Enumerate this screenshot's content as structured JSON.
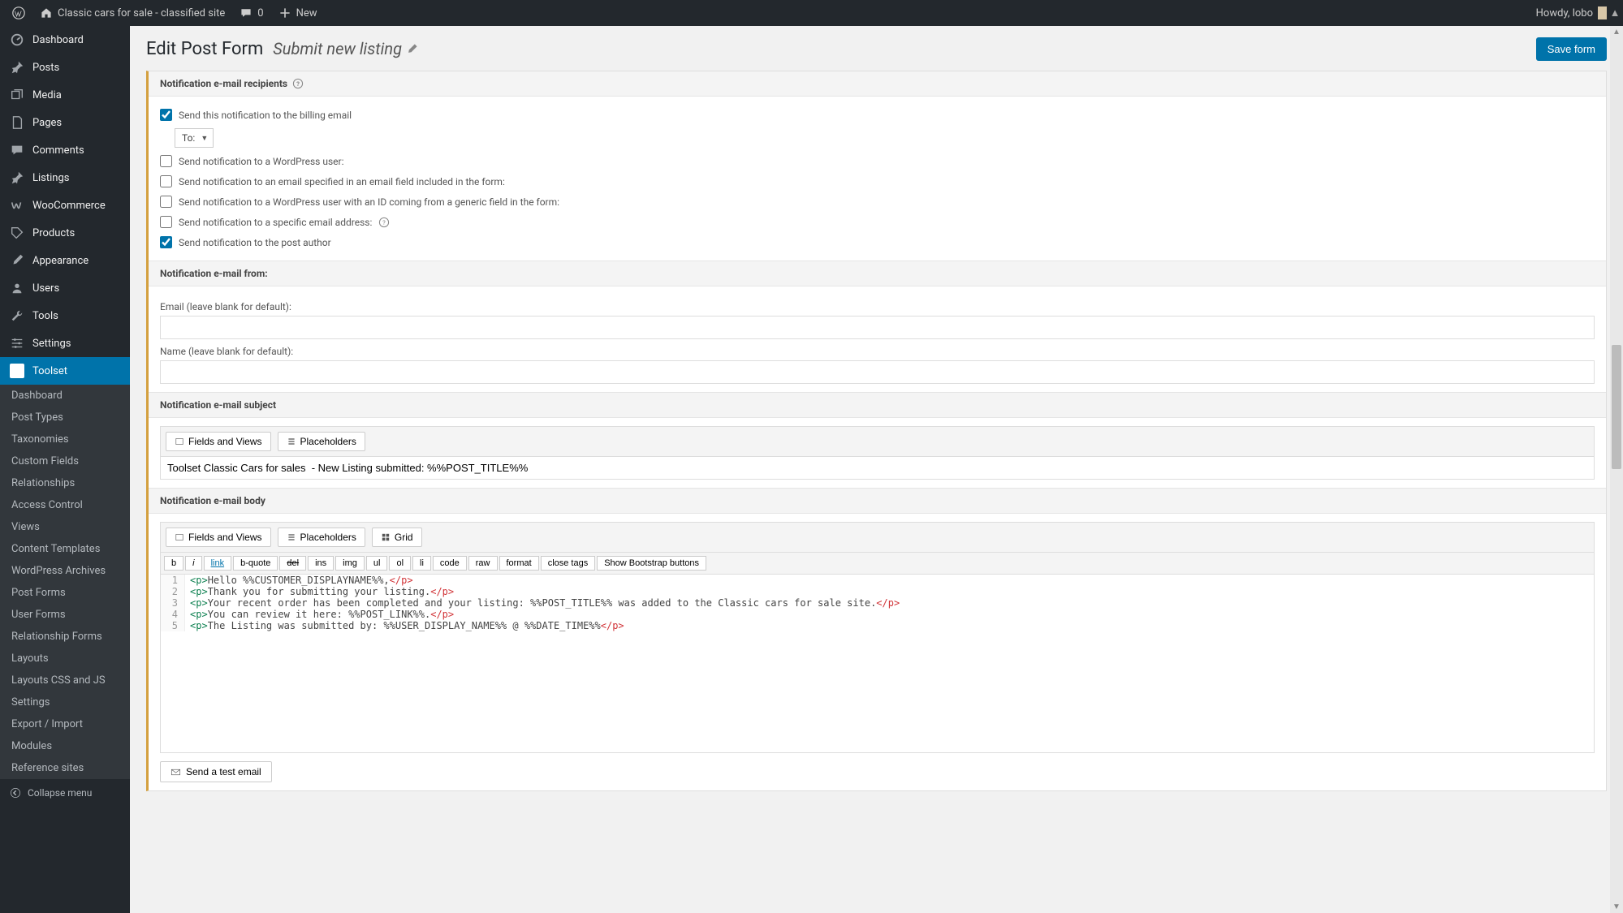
{
  "adminbar": {
    "site": "Classic cars for sale - classified site",
    "comments": "0",
    "new": "New",
    "howdy": "Howdy, lobo"
  },
  "sidebar": {
    "items": [
      {
        "label": "Dashboard"
      },
      {
        "label": "Posts"
      },
      {
        "label": "Media"
      },
      {
        "label": "Pages"
      },
      {
        "label": "Comments"
      },
      {
        "label": "Listings"
      },
      {
        "label": "WooCommerce"
      },
      {
        "label": "Products"
      },
      {
        "label": "Appearance"
      },
      {
        "label": "Users"
      },
      {
        "label": "Tools"
      },
      {
        "label": "Settings"
      },
      {
        "label": "Toolset"
      }
    ],
    "sub": [
      "Dashboard",
      "Post Types",
      "Taxonomies",
      "Custom Fields",
      "Relationships",
      "Access Control",
      "Views",
      "Content Templates",
      "WordPress Archives",
      "Post Forms",
      "User Forms",
      "Relationship Forms",
      "Layouts",
      "Layouts CSS and JS",
      "Settings",
      "Export / Import",
      "Modules",
      "Reference sites"
    ],
    "collapse": "Collapse menu"
  },
  "page": {
    "title": "Edit Post Form",
    "subtitle": "Submit new listing",
    "save": "Save form"
  },
  "sections": {
    "recipients": "Notification e-mail recipients",
    "from": "Notification e-mail from:",
    "subject": "Notification e-mail subject",
    "body": "Notification e-mail body"
  },
  "recipients": {
    "billing": "Send this notification to the billing email",
    "to": "To:",
    "wp_user": "Send notification to a WordPress user:",
    "email_field": "Send notification to an email specified in an email field included in the form:",
    "wp_user_id": "Send notification to a WordPress user with an ID coming from a generic field in the form:",
    "specific": "Send notification to a specific email address:",
    "author": "Send notification to the post author"
  },
  "from": {
    "email_label": "Email (leave blank for default):",
    "name_label": "Name (leave blank for default):"
  },
  "tools": {
    "fields": "Fields and Views",
    "placeholders": "Placeholders",
    "grid": "Grid"
  },
  "subject_value": "Toolset Classic Cars for sales  - New Listing submitted: %%POST_TITLE%%",
  "quicktags": [
    "b",
    "i",
    "link",
    "b-quote",
    "del",
    "ins",
    "img",
    "ul",
    "ol",
    "li",
    "code",
    "raw",
    "format",
    "close tags",
    "Show Bootstrap buttons"
  ],
  "code": {
    "l1_open": "<p>",
    "l1_text": "Hello %%CUSTOMER_DISPLAYNAME%%,",
    "l1_close": "</p>",
    "l2_open": "<p>",
    "l2_text": "Thank you for submitting your listing.",
    "l2_close": "</p>",
    "l3_open": "<p>",
    "l3_text": "Your recent order has been completed and your listing: %%POST_TITLE%% was added to the Classic cars for sale site.",
    "l3_close": "</p>",
    "l4_open": "<p>",
    "l4_text": "You can review it here: %%POST_LINK%%.",
    "l4_close": "</p>",
    "l5_open": "<p>",
    "l5_text": "The Listing was submitted by: %%USER_DISPLAY_NAME%% @ %%DATE_TIME%%",
    "l5_close": "</p>"
  },
  "test_email": "Send a test email"
}
